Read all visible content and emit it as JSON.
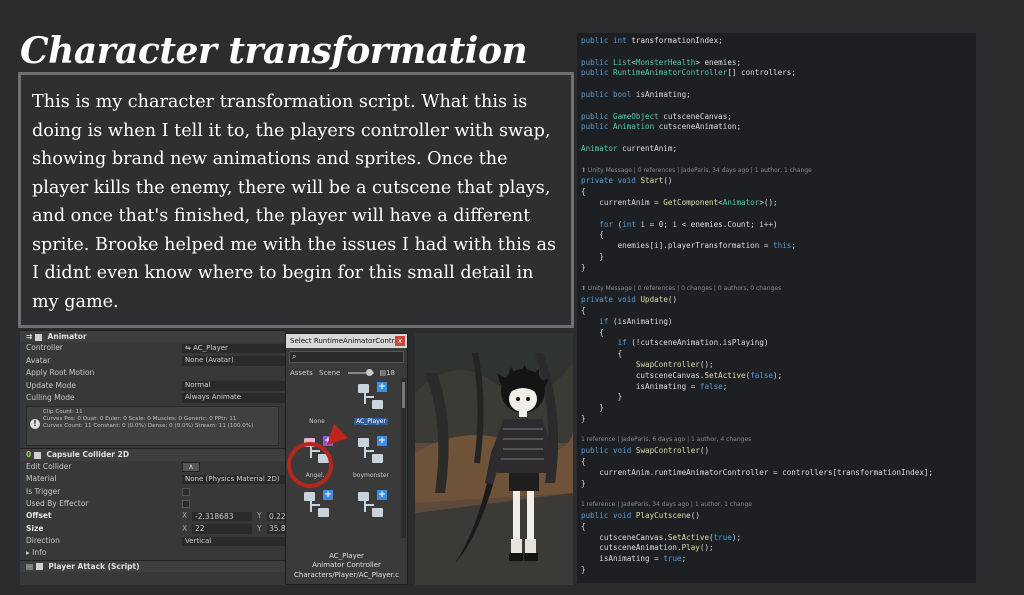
{
  "title": "Character transformation",
  "description": "This is my character transformation script. What this is doing is when I tell it to, the players controller with swap, showing brand new animations and sprites. Once the player kills the enemy, there will be a cutscene that plays, and once that's finished, the player will have a different sprite.  Brooke helped me with the issues I had with this as I didnt even know where to begin for this small detail in my game.",
  "inspector": {
    "animator_header": "Animator",
    "controller_label": "Controller",
    "controller_value": "⇋ AC_Player",
    "avatar_label": "Avatar",
    "avatar_value": "None (Avatar)",
    "apply_root_motion_label": "Apply Root Motion",
    "update_mode_label": "Update Mode",
    "update_mode_value": "Normal",
    "culling_mode_label": "Culling Mode",
    "culling_mode_value": "Always Animate",
    "info_line1": "Clip Count: 11",
    "info_line2": "Curves Pos: 0 Quat: 0 Euler: 0 Scale: 0 Muscles: 0 Generic: 0 PPtr: 11",
    "info_line3": "Curves Count: 11 Constant: 0 (0.0%) Dense: 0 (0.0%) Stream: 11 (100.0%)",
    "capsule_header": "Capsule Collider 2D",
    "edit_collider_label": "Edit Collider",
    "material_label": "Material",
    "material_value": "None (Physics Material 2D)",
    "is_trigger_label": "Is Trigger",
    "used_by_effector_label": "Used By Effector",
    "offset_label": "Offset",
    "offset_x": "-2.318683",
    "offset_y": "0.22(",
    "size_label": "Size",
    "size_x": "22",
    "size_y": "35.83",
    "direction_label": "Direction",
    "direction_value": "Vertical",
    "info_label": "Info",
    "player_attack_header": "Player Attack (Script)",
    "x_label": "X",
    "y_label": "Y"
  },
  "select_dialog": {
    "title": "Select RuntimeAnimatorContr...",
    "close_label": "x",
    "tab_assets": "Assets",
    "tab_scene": "Scene",
    "count": "18",
    "items": [
      "None",
      "AC_Player",
      "Angel...",
      "boymonster",
      "",
      ""
    ],
    "footer_name": "AC_Player",
    "footer_type": "Animator Controller",
    "footer_path": "Characters/Player/AC_Player.c"
  },
  "code": {
    "lines": [
      "public int transformationIndex;",
      "",
      "public List<MonsterHealth> enemies;",
      "public RuntimeAnimatorController[] controllers;",
      "",
      "public bool isAnimating;",
      "",
      "public GameObject cutsceneCanvas;",
      "public Animation cutsceneAnimation;",
      "",
      "Animator currentAnim;",
      "",
      "⬆ Unity Message | 0 references | JadeParis, 34 days ago | 1 author, 1 change",
      "private void Start()",
      "{",
      "    currentAnim = GetComponent<Animator>();",
      "",
      "    for (int i = 0; i < enemies.Count; i++)",
      "    {",
      "        enemies[i].playerTransformation = this;",
      "    }",
      "}",
      "",
      "⬆ Unity Message | 0 references | 0 changes | 0 authors, 0 changes",
      "private void Update()",
      "{",
      "    if (isAnimating)",
      "    {",
      "        if (!cutsceneAnimation.isPlaying)",
      "        {",
      "            SwapController();",
      "            cutsceneCanvas.SetActive(false);",
      "            isAnimating = false;",
      "        }",
      "    }",
      "}",
      "",
      "1 reference | JadeParis, 6 days ago | 1 author, 4 changes",
      "public void SwapController()",
      "{",
      "    currentAnim.runtimeAnimatorController = controllers[transformationIndex];",
      "}",
      "",
      "1 reference | JadeParis, 34 days ago | 1 author, 1 change",
      "public void PlayCutscene()",
      "{",
      "    cutsceneCanvas.SetActive(true);",
      "    cutsceneAnimation.Play();",
      "    isAnimating = true;",
      "}"
    ],
    "meta_lines": [
      12,
      23,
      37,
      43
    ]
  },
  "colors": {
    "background": "#2a2c2e",
    "code_background": "#1e1f22",
    "keyword": "#569cd6",
    "type": "#4ec9b0",
    "method": "#dcdcaa",
    "highlight_red": "#b3271f",
    "selection_blue": "#2d5d9b"
  }
}
